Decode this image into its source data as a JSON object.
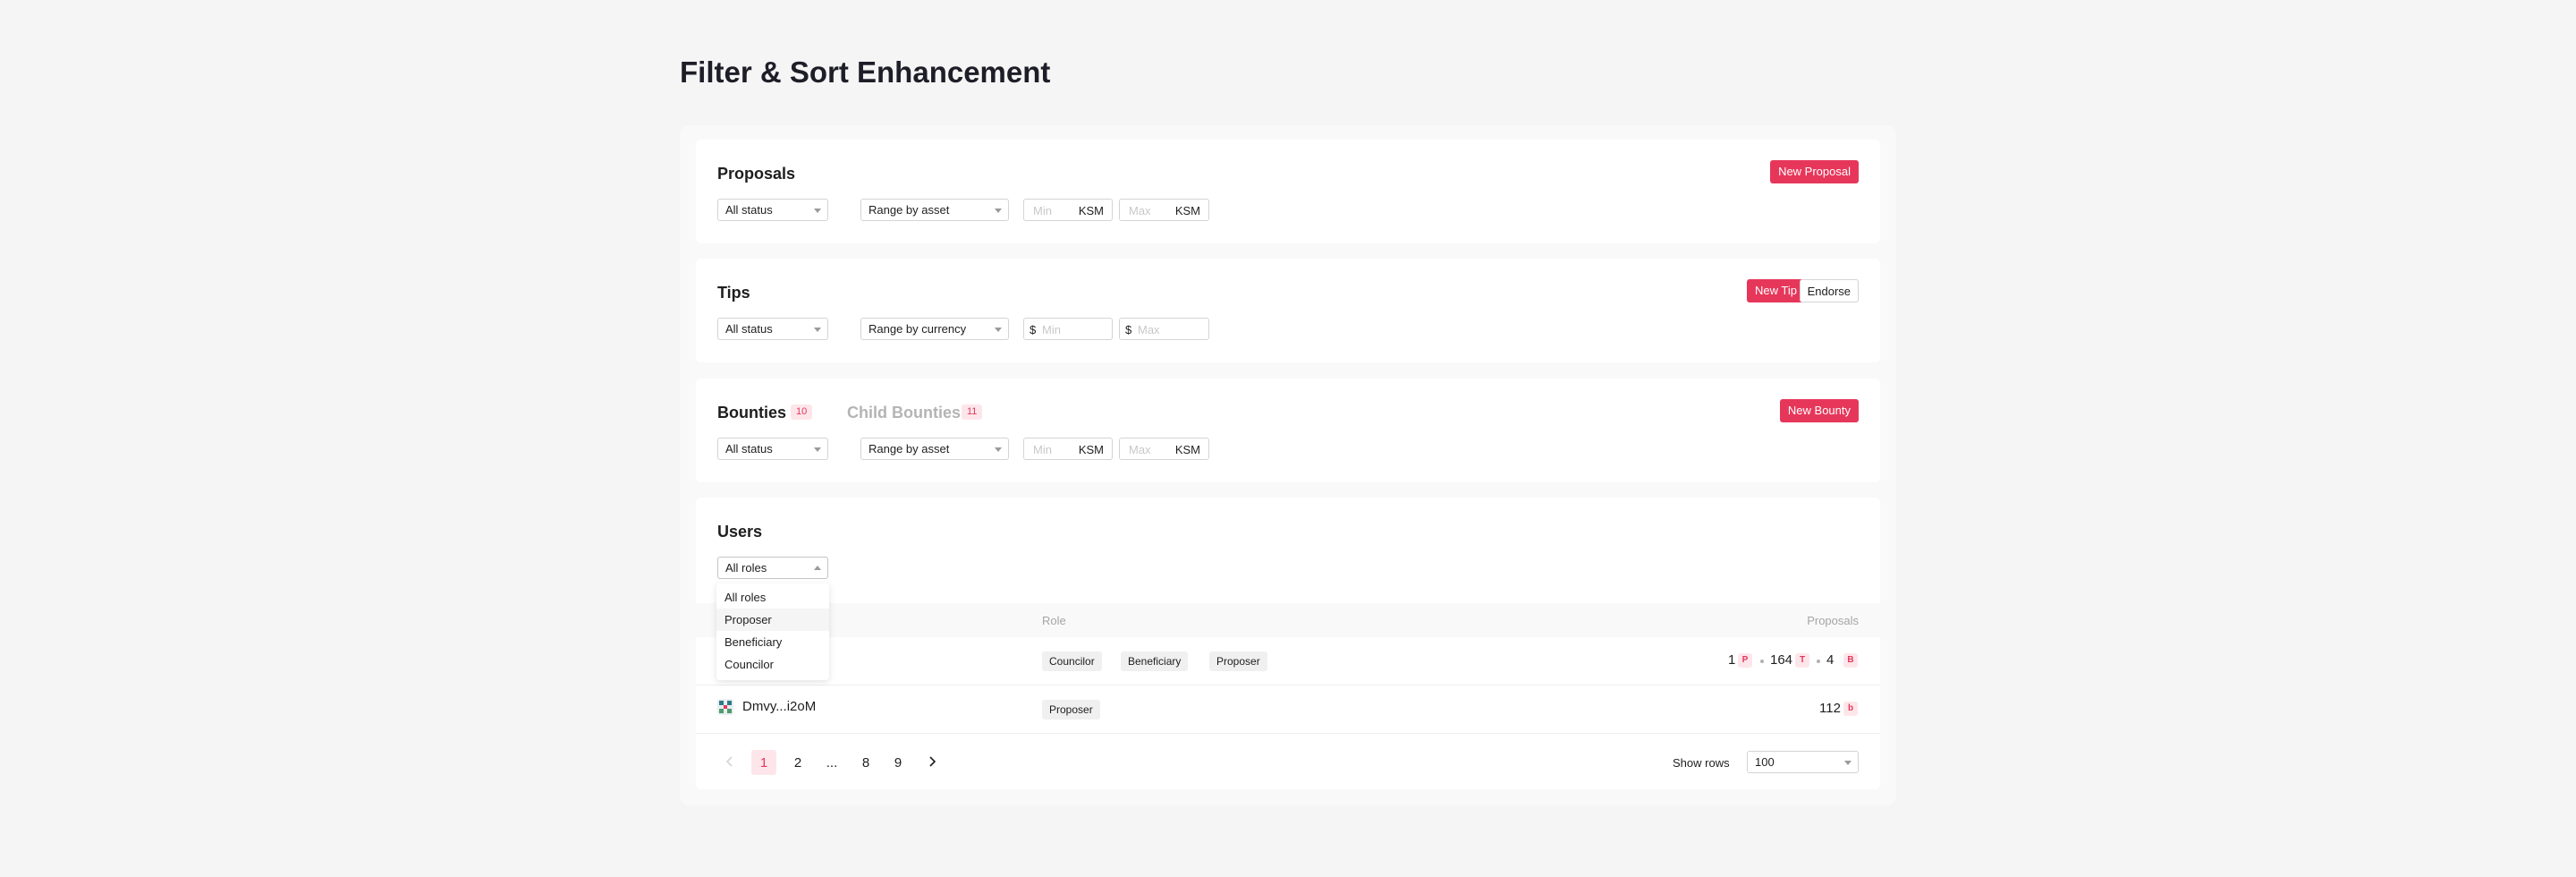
{
  "page": {
    "title": "Filter & Sort Enhancement"
  },
  "proposals": {
    "title": "Proposals",
    "new_button": "New Proposal",
    "status_select": "All status",
    "range_select": "Range by asset",
    "min_placeholder": "Min",
    "max_placeholder": "Max",
    "unit": "KSM"
  },
  "tips": {
    "title": "Tips",
    "new_button": "New Tip",
    "endorse_button": "Endorse",
    "status_select": "All status",
    "range_select": "Range by currency",
    "currency_prefix": "$",
    "min_placeholder": "Min",
    "max_placeholder": "Max"
  },
  "bounties": {
    "title": "Bounties",
    "count": "10",
    "child_title": "Child Bounties",
    "child_count": "11",
    "new_button": "New Bounty",
    "status_select": "All status",
    "range_select": "Range by asset",
    "min_placeholder": "Min",
    "max_placeholder": "Max",
    "unit": "KSM"
  },
  "users": {
    "title": "Users",
    "role_select": "All roles",
    "dropdown_options": [
      "All roles",
      "Proposer",
      "Beneficiary",
      "Councilor"
    ],
    "columns": {
      "role": "Role",
      "proposals": "Proposals"
    },
    "rows": [
      {
        "name": "",
        "roles": [
          "Councilor",
          "Beneficiary",
          "Proposer"
        ],
        "stats": [
          {
            "value": "1",
            "tag": "P"
          },
          {
            "value": "164",
            "tag": "T"
          },
          {
            "value": "4",
            "tag": "B"
          }
        ]
      },
      {
        "name": "Dmvy...i2oM",
        "roles": [
          "Proposer"
        ],
        "stats": [
          {
            "value": "112",
            "tag": "b"
          }
        ]
      }
    ],
    "pagination": {
      "prev_icon": "chevron-left-icon",
      "next_icon": "chevron-right-icon",
      "pages": [
        "1",
        "2",
        "...",
        "8",
        "9"
      ],
      "current": "1",
      "show_rows_label": "Show rows",
      "rows_per_page": "100"
    }
  },
  "colors": {
    "accent": "#e6375b",
    "accent_light": "#fde6ea",
    "background": "#f5f5f5"
  }
}
